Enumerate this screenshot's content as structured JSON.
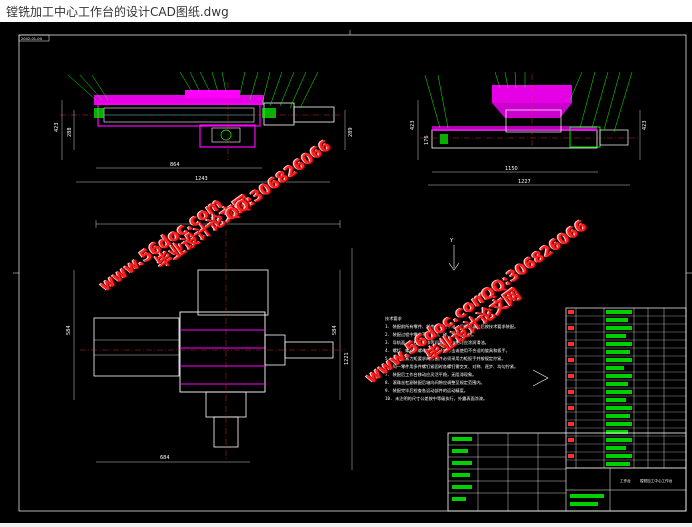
{
  "window": {
    "title": "镗铣加工中心工作台的设计CAD图纸.dwg"
  },
  "drawing": {
    "dimensions": {
      "front_len1": "864",
      "front_len2": "1243",
      "front_h1": "423",
      "front_h2": "288",
      "front_h3": "289",
      "side_len1": "1150",
      "side_len2": "1227",
      "side_h1": "423",
      "side_h2": "423",
      "side_h3": "176",
      "plan_w": "1044",
      "plan_h1": "584",
      "plan_h2": "584",
      "plan_h3": "1221",
      "plan_bottom": "684"
    },
    "arrow_label": "Y",
    "notes_heading": "技术要求",
    "notes": [
      "1. 装配前所有零件、部件需清洗干净，用煤油清洗后按技术要求装配。",
      "2. 装配过程中零件不允许磕、碰、划伤和锈蚀。",
      "3. 导轨面、丝杠、轴承等润滑部位装配时应涂润滑油。",
      "4. 螺钉、螺栓和螺母紧固时严禁打击或使用不合适的旋具和扳手。",
      "5. 规定拧紧力矩要求的紧固件必须采用力矩扳手并按规定拧紧。",
      "6. 同一零件用多件螺钉紧固时各螺钉需交叉、对称、逐步、均匀拧紧。",
      "7. 装配后工作台移动应灵活平稳，无阻滞现象。",
      "8. 滚珠丝杠副装配后轴向间隙应调整至规定范围内。",
      "9. 装配完毕后检查各运动部件的运动精度。",
      "10. 未注明的尺寸公差按中等级执行，外露表面涂漆。"
    ],
    "titleblock_name": "工作台",
    "titleblock_sub": "镗铣加工中心工作台",
    "corner_tag": "2002-01-00"
  },
  "watermarks": {
    "site": "www.56doc.com",
    "qq": "QQ:306826066",
    "name": "毕业设计论文网"
  },
  "colors": {
    "background": "#000000",
    "outline": "#ffffff",
    "part": "#ff00ff",
    "leader": "#00ff00",
    "axis": "#ff3030",
    "section": "#00ffff",
    "dim": "#ffffff",
    "note": "#ffffff",
    "title_green": "#00d000",
    "title_red": "#ff3030"
  }
}
